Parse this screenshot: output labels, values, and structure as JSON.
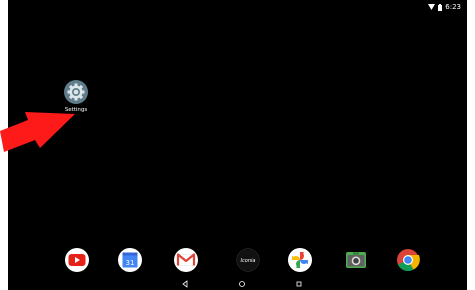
{
  "status_bar": {
    "time": "6:23",
    "icons": [
      "wifi-icon",
      "battery-icon"
    ]
  },
  "desktop": {
    "shortcuts": [
      {
        "label": "Settings",
        "icon": "gear-icon"
      }
    ]
  },
  "dock": {
    "apps": [
      {
        "name": "YouTube",
        "icon": "youtube-icon"
      },
      {
        "name": "Calendar",
        "icon": "calendar-icon",
        "text": "31"
      },
      {
        "name": "Gmail",
        "icon": "gmail-icon"
      },
      {
        "name": "Iconia",
        "icon": "iconia-icon",
        "text": "Iconia"
      },
      {
        "name": "Photos",
        "icon": "photos-icon"
      },
      {
        "name": "Camera",
        "icon": "camera-icon"
      },
      {
        "name": "Chrome",
        "icon": "chrome-icon"
      }
    ]
  },
  "nav_bar": {
    "buttons": [
      "back-icon",
      "home-icon",
      "recents-icon"
    ]
  },
  "colors": {
    "background": "#000000",
    "annotation_arrow": "#ff0000"
  }
}
